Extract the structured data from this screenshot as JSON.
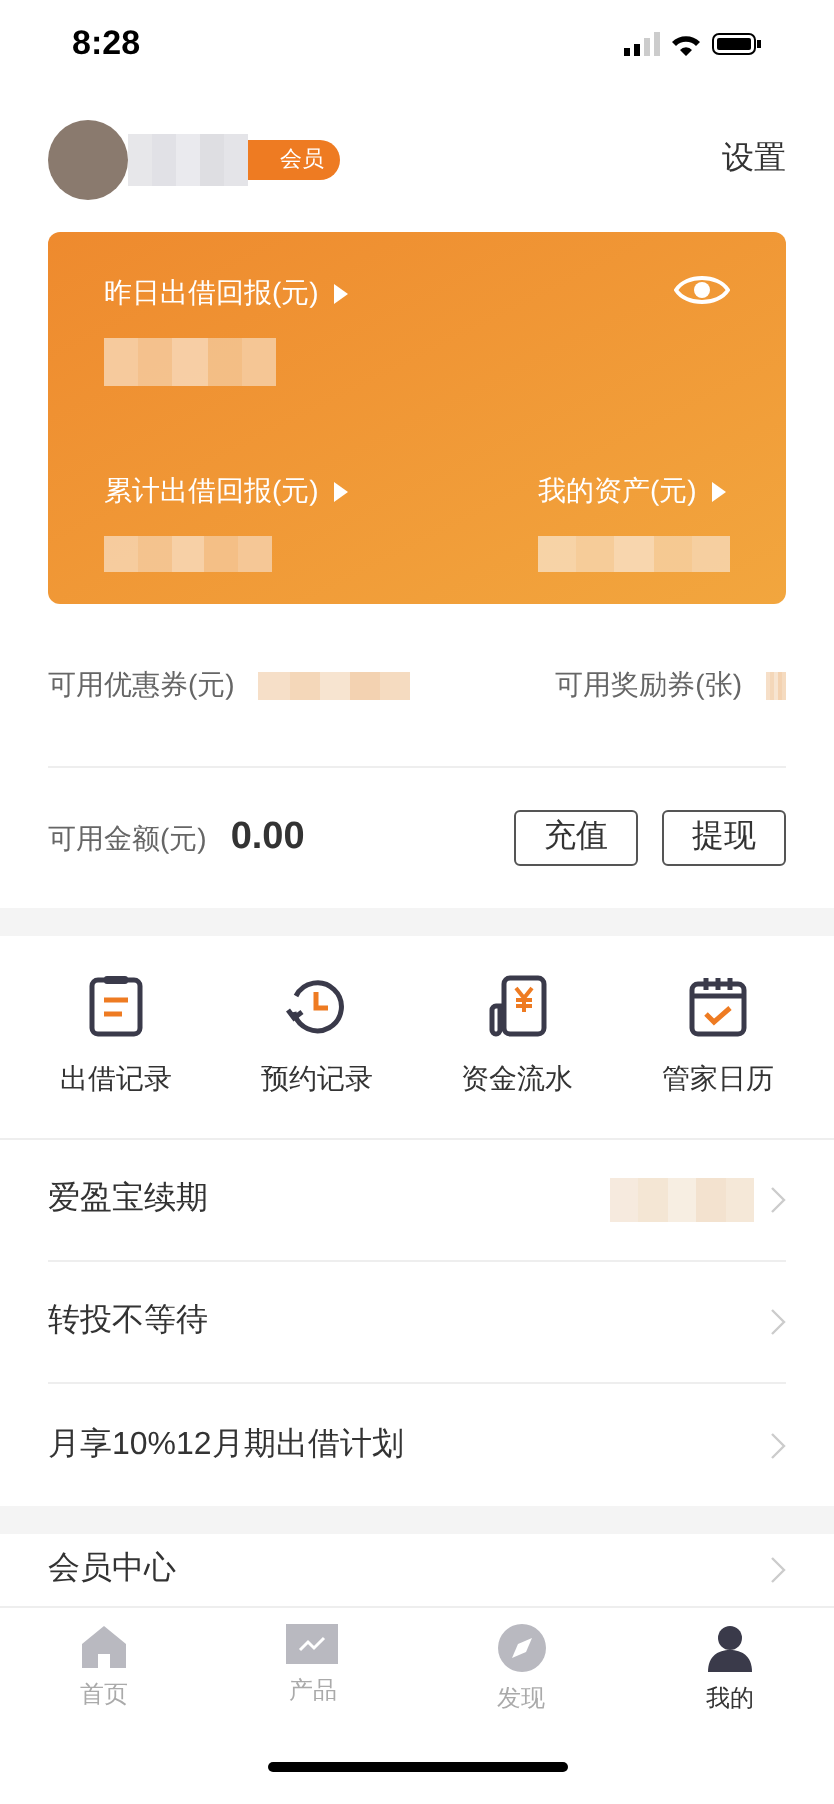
{
  "status_bar": {
    "time": "8:28"
  },
  "header": {
    "badge": "会员",
    "settings": "设置"
  },
  "card": {
    "yesterday_label": "昨日出借回报(元)",
    "total_label": "累计出借回报(元)",
    "assets_label": "我的资产(元)"
  },
  "vouchers": [
    {
      "label": "可用优惠券(元)"
    },
    {
      "label": "可用奖励券(张)"
    }
  ],
  "balance": {
    "label": "可用金额(元)",
    "value": "0.00",
    "buttons": [
      "充值",
      "提现"
    ]
  },
  "shortcuts": [
    {
      "label": "出借记录",
      "kind": "clipboard"
    },
    {
      "label": "预约记录",
      "kind": "history"
    },
    {
      "label": "资金流水",
      "kind": "ledger"
    },
    {
      "label": "管家日历",
      "kind": "calendar"
    }
  ],
  "menu": [
    {
      "label": "爱盈宝续期",
      "blurred": true
    },
    {
      "label": "转投不等待",
      "blurred": false
    },
    {
      "label": "月享10%12月期出借计划",
      "blurred": false
    }
  ],
  "menu2": [
    {
      "label": "会员中心"
    }
  ],
  "tabs": [
    {
      "label": "首页",
      "kind": "home",
      "selected": false
    },
    {
      "label": "产品",
      "kind": "chart",
      "selected": false
    },
    {
      "label": "发现",
      "kind": "compass",
      "selected": false
    },
    {
      "label": "我的",
      "kind": "person",
      "selected": true
    }
  ]
}
